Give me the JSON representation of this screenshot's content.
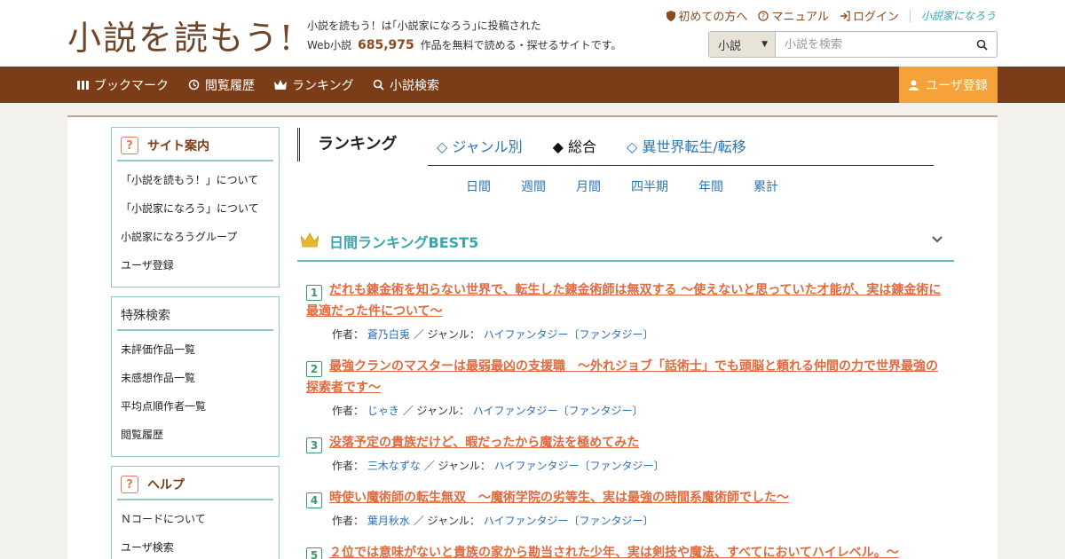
{
  "header": {
    "logo_text": "小説を読もう!",
    "tagline_line1": "小説を読もう！は｢小説家になろう｣に投稿された",
    "tagline_prefix": "Web小説",
    "work_count": "685,975",
    "tagline_suffix": "作品を無料で読める・探せるサイトです。",
    "links": {
      "first_time": "初めての方へ",
      "manual": "マニュアル",
      "login": "ログイン",
      "narou": "小説家になろう"
    },
    "search": {
      "category": "小説",
      "placeholder": "小説を検索"
    }
  },
  "nav": {
    "bookmark": "ブックマーク",
    "history": "閲覧履歴",
    "ranking": "ランキング",
    "search": "小説検索",
    "register": "ユーザ登録"
  },
  "sidebar": {
    "site_guide": {
      "title": "サイト案内",
      "items": [
        "「小説を読もう！」について",
        "「小説家になろう」について",
        "小説家になろうグループ",
        "ユーザ登録"
      ]
    },
    "special_search": {
      "title": "特殊検索",
      "items": [
        "未評価作品一覧",
        "未感想作品一覧",
        "平均点順作者一覧",
        "閲覧履歴"
      ]
    },
    "help": {
      "title": "ヘルプ",
      "items": [
        "Ｎコードについて",
        "ユーザ検索"
      ]
    }
  },
  "main": {
    "title": "ランキング",
    "tabs": [
      "◇ ジャンル別",
      "◆ 総合",
      "◇ 異世界転生/転移"
    ],
    "periods": [
      "日間",
      "週間",
      "月間",
      "四半期",
      "年間",
      "累計"
    ],
    "section_title": "日間ランキングBEST5",
    "author_label": "作者：",
    "genre_label": "／ ジャンル：",
    "entries": [
      {
        "rank": "1",
        "title": "だれも錬金術を知らない世界で、転生した錬金術師は無双する 〜使えないと思っていた才能が、実は錬金術に最適だった件について〜",
        "author": "蒼乃白兎",
        "genre": "ハイファンタジー〔ファンタジー〕"
      },
      {
        "rank": "2",
        "title": "最強クランのマスターは最弱最凶の支援職　～外れジョブ「話術士」でも頭脳と頼れる仲間の力で世界最強の探索者です～",
        "author": "じゃき",
        "genre": "ハイファンタジー〔ファンタジー〕"
      },
      {
        "rank": "3",
        "title": "没落予定の貴族だけど、暇だったから魔法を極めてみた",
        "author": "三木なずな",
        "genre": "ハイファンタジー〔ファンタジー〕"
      },
      {
        "rank": "4",
        "title": "時使い魔術師の転生無双　～魔術学院の劣等生、実は最強の時間系魔術師でした～",
        "author": "葉月秋水",
        "genre": "ハイファンタジー〔ファンタジー〕"
      },
      {
        "rank": "5",
        "title": "２位では意味がないと貴族の家から勘当された少年、実は剣技や魔法、すべてにおいてハイレベル。～"
      }
    ]
  }
}
